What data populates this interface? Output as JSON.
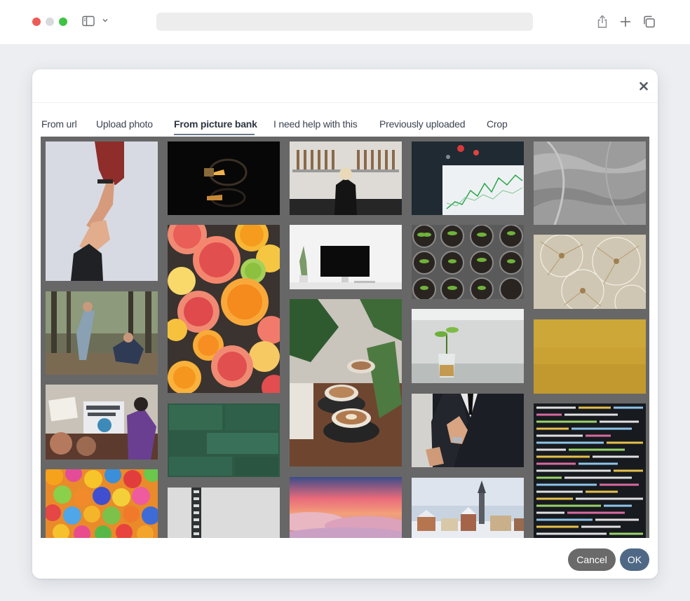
{
  "browser": {
    "icons": [
      "sidebar-icon",
      "chevron-down-icon",
      "share-icon",
      "plus-icon",
      "tabs-overview-icon"
    ]
  },
  "modal": {
    "close_icon": "close-icon",
    "tabs": [
      {
        "label": "From url",
        "active": false
      },
      {
        "label": "Upload photo",
        "active": false
      },
      {
        "label": "From picture bank",
        "active": true
      },
      {
        "label": "I need help with this",
        "active": false
      },
      {
        "label": "Previously uploaded",
        "active": false
      },
      {
        "label": "Crop",
        "active": false
      }
    ],
    "gallery": {
      "columns": [
        [
          "hands-reaching",
          "forest-children",
          "climate-protest",
          "colorful-balls"
        ],
        [
          "light-bulb",
          "citrus-slices",
          "green-tiles",
          "film-strip"
        ],
        [
          "beer-taps",
          "desk-monitor",
          "latte-cups",
          "sunset-clouds"
        ],
        [
          "stock-chart",
          "seedlings-tray",
          "plant-coins-jar",
          "businessman-suit",
          "winter-town"
        ],
        [
          "grey-texture",
          "dandelion-seeds",
          "gold-texture",
          "code-screen"
        ]
      ]
    },
    "footer": {
      "cancel_label": "Cancel",
      "ok_label": "OK"
    }
  },
  "colors": {
    "gallery_bg": "#676767",
    "ok_button": "#4f6885",
    "cancel_button": "#6a6a6a",
    "active_tab_underline": "#6b7a8c"
  }
}
